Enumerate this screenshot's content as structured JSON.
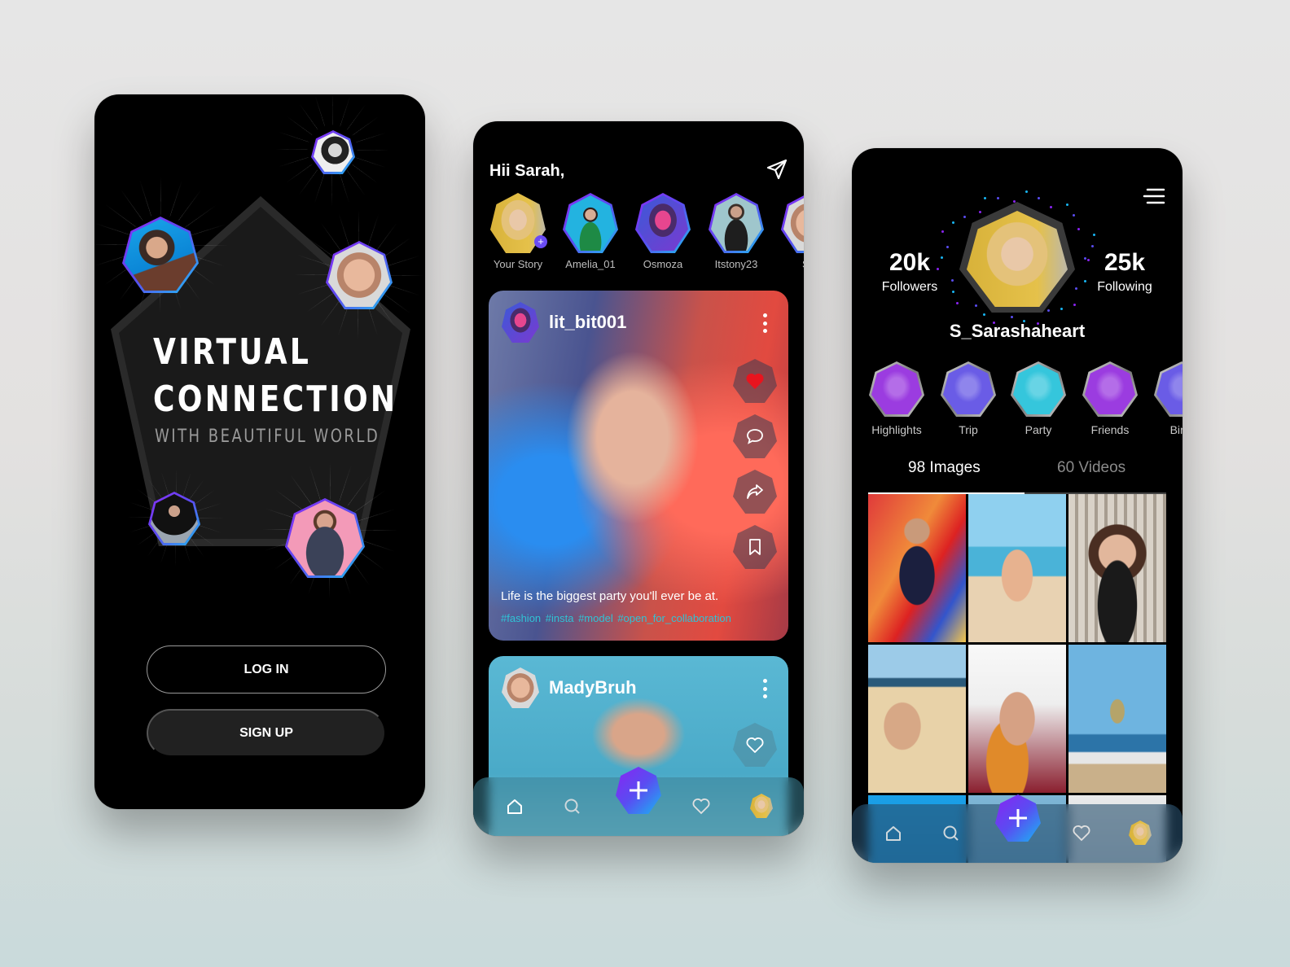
{
  "login_screen": {
    "title_line1": "VIRTUAL",
    "title_line2": "CONNECTION",
    "subtitle": "WITH BEAUTIFUL WORLD",
    "login_button": "LOG IN",
    "signup_button": "SIGN UP"
  },
  "feed_screen": {
    "greeting": "Hii Sarah,",
    "send_icon": "paper-plane-icon",
    "stories": [
      {
        "label": "Your Story",
        "own": true
      },
      {
        "label": "Amelia_01"
      },
      {
        "label": "Osmoza"
      },
      {
        "label": "Itstony23"
      },
      {
        "label": "Sa"
      }
    ],
    "posts": [
      {
        "username": "lit_bit001",
        "caption": "Life is the biggest party you'll ever be at.",
        "hashtags": "#fashion  #insta #model #open_for_collaboration",
        "liked": true,
        "actions": [
          "heart-icon",
          "comment-icon",
          "share-icon",
          "bookmark-icon"
        ]
      },
      {
        "username": "MadyBruh",
        "liked": false,
        "actions": [
          "heart-icon"
        ]
      }
    ]
  },
  "profile_screen": {
    "menu_icon": "hamburger-menu-icon",
    "followers_count": "20k",
    "followers_label": "Followers",
    "following_count": "25k",
    "following_label": "Following",
    "username": "S_Sarashaheart",
    "highlights": [
      {
        "label": "Highlights",
        "tint": "#9b3ce0"
      },
      {
        "label": "Trip",
        "tint": "#6a5ce6"
      },
      {
        "label": "Party",
        "tint": "#35c6dc"
      },
      {
        "label": "Friends",
        "tint": "#9b3ce0"
      },
      {
        "label": "Birth",
        "tint": "#6a5ce6"
      }
    ],
    "tabs": [
      {
        "label": "98 Images",
        "active": true
      },
      {
        "label": "60 Videos",
        "active": false
      }
    ]
  },
  "bottom_nav": {
    "items": [
      "home-icon",
      "search-icon",
      "add-icon",
      "heart-icon",
      "profile-avatar"
    ]
  },
  "colors": {
    "accent_purple": "#8a24f3",
    "accent_blue": "#18b6f3",
    "hashtag": "#2fc3d6",
    "like_red": "#e8141e",
    "background": "#000000"
  }
}
